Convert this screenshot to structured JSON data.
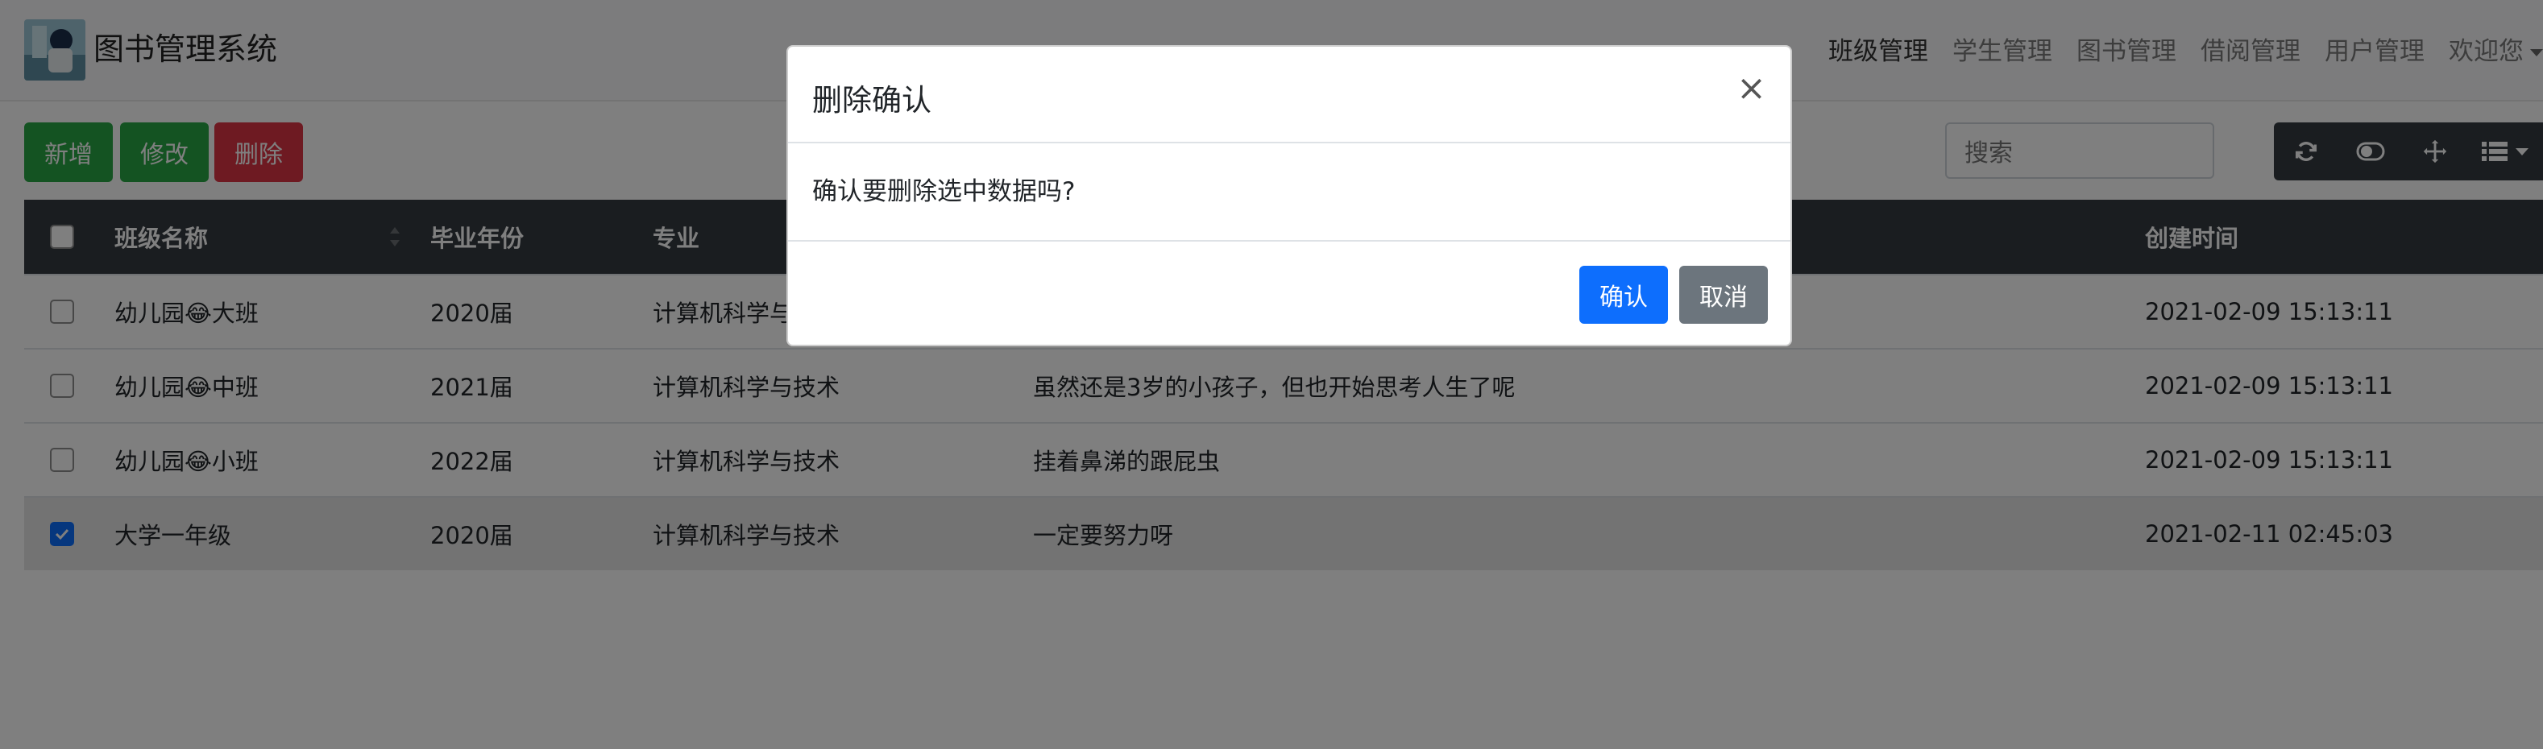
{
  "app": {
    "title": "图书管理系统"
  },
  "nav": {
    "items": [
      "班级管理",
      "学生管理",
      "图书管理",
      "借阅管理",
      "用户管理"
    ],
    "welcome": "欢迎您"
  },
  "toolbar": {
    "add_label": "新增",
    "edit_label": "修改",
    "delete_label": "删除",
    "search_placeholder": "搜索"
  },
  "table": {
    "headers": {
      "name": "班级名称",
      "year": "毕业年份",
      "major": "专业",
      "created": "创建时间"
    },
    "rows": [
      {
        "name": "幼儿园😂大班",
        "year": "2020届",
        "major": "计算机科学与技术",
        "desc": "",
        "created": "2021-02-09 15:13:11",
        "checked": false
      },
      {
        "name": "幼儿园😂中班",
        "year": "2021届",
        "major": "计算机科学与技术",
        "desc": "虽然还是3岁的小孩子，但也开始思考人生了呢",
        "created": "2021-02-09 15:13:11",
        "checked": false
      },
      {
        "name": "幼儿园😂小班",
        "year": "2022届",
        "major": "计算机科学与技术",
        "desc": "挂着鼻涕的跟屁虫",
        "created": "2021-02-09 15:13:11",
        "checked": false
      },
      {
        "name": "大学一年级",
        "year": "2020届",
        "major": "计算机科学与技术",
        "desc": "一定要努力呀",
        "created": "2021-02-11 02:45:03",
        "checked": true
      }
    ]
  },
  "modal": {
    "title": "删除确认",
    "close": "×",
    "message": "确认要删除选中数据吗?",
    "confirm_label": "确认",
    "cancel_label": "取消"
  },
  "colors": {
    "success": "#28a745",
    "danger": "#dc3545",
    "primary": "#0d6efd",
    "secondary": "#6c757d",
    "dark": "#343a40"
  }
}
